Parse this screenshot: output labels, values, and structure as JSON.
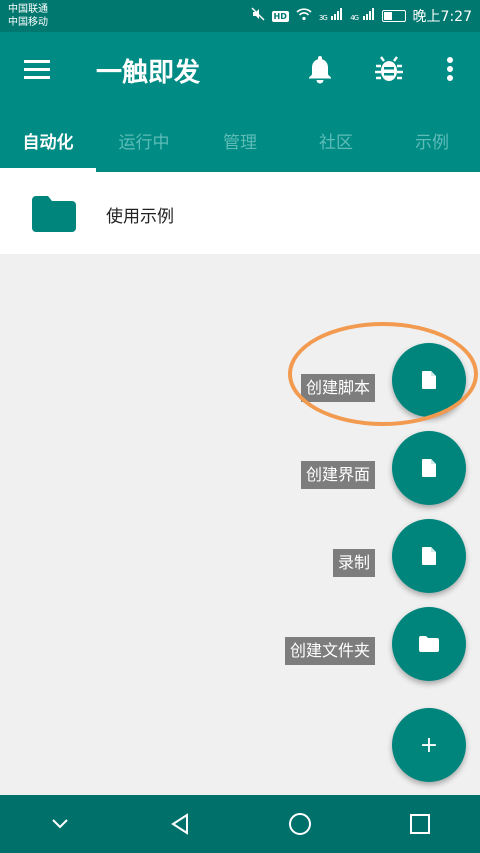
{
  "status_bar": {
    "carrier_1": "中国联通",
    "carrier_2": "中国移动",
    "hd_badge": "HD",
    "signal_1_label": "3G",
    "signal_2_label": "4G",
    "time": "晚上7:27"
  },
  "app_bar": {
    "title": "一触即发",
    "menu_icon": "hamburger-icon",
    "notification_icon": "bell-icon",
    "debug_icon": "bug-icon",
    "more_icon": "more-vert-icon"
  },
  "tabs": [
    {
      "label": "自动化",
      "active": true
    },
    {
      "label": "运行中",
      "active": false
    },
    {
      "label": "管理",
      "active": false
    },
    {
      "label": "社区",
      "active": false
    },
    {
      "label": "示例",
      "active": false
    }
  ],
  "list": [
    {
      "label": "使用示例",
      "icon": "folder-icon"
    }
  ],
  "fab_menu": {
    "items": [
      {
        "label": "创建脚本",
        "icon": "file-icon"
      },
      {
        "label": "创建界面",
        "icon": "file-icon"
      },
      {
        "label": "录制",
        "icon": "file-icon"
      },
      {
        "label": "创建文件夹",
        "icon": "folder-icon"
      }
    ],
    "main_button": "+"
  },
  "colors": {
    "primary": "#008b84",
    "status_bar": "#00786f",
    "nav_bar": "#00706a",
    "fab": "#00857d",
    "highlight": "#f29a4f",
    "label_bg": "#7d7d7d"
  }
}
